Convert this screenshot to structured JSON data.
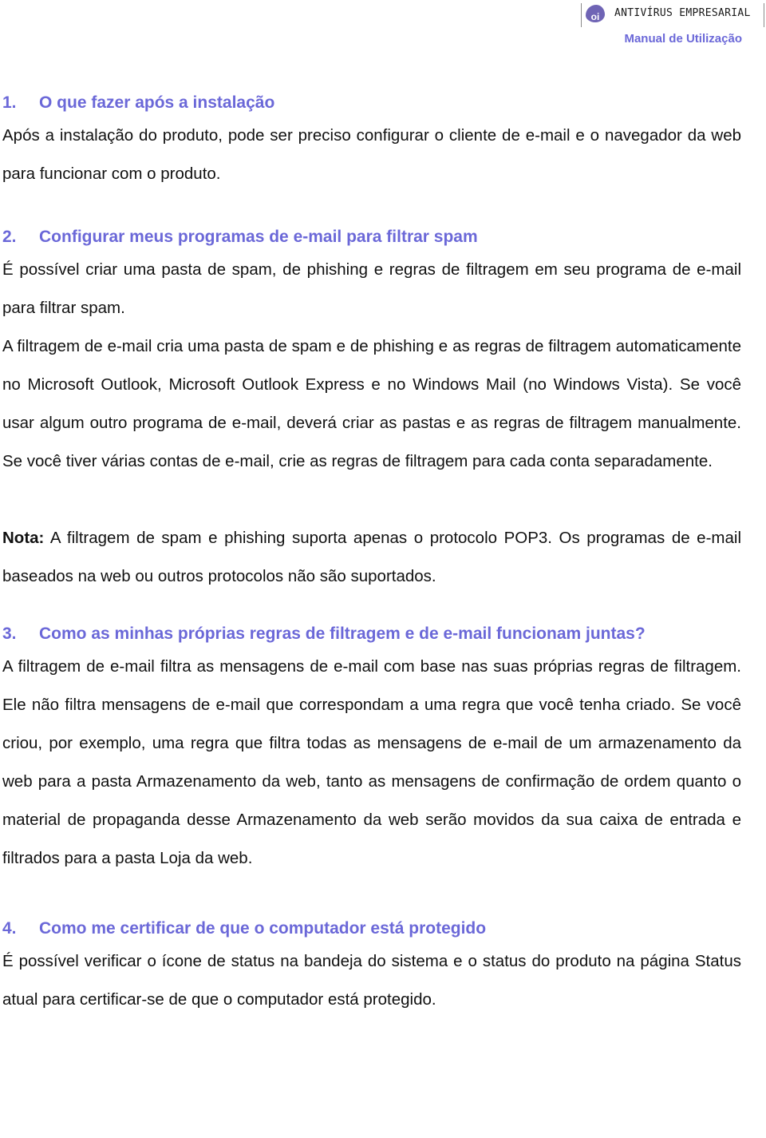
{
  "header": {
    "logo_text": "oi",
    "brand": "ANTIVÍRUS EMPRESARIAL",
    "subtitle": "Manual de Utilização",
    "accent_color": "#6b68d8",
    "logo_color": "#6f64b5"
  },
  "sections": [
    {
      "number": "1.",
      "title": "O que fazer após a instalação",
      "paragraphs": [
        "Após a instalação do produto, pode ser preciso configurar o cliente de e-mail e o navegador da web para funcionar com o produto."
      ]
    },
    {
      "number": "2.",
      "title": "Configurar meus programas de e-mail para filtrar spam",
      "paragraphs": [
        "É possível criar uma pasta de spam, de phishing e regras de filtragem em seu programa de e-mail para filtrar spam.",
        "A filtragem de e-mail cria uma pasta de spam e de phishing e as regras de filtragem automaticamente no Microsoft Outlook, Microsoft Outlook Express e no Windows Mail (no Windows Vista). Se você usar algum outro programa de e-mail, deverá criar as pastas e as regras de filtragem manualmente. Se você tiver várias contas de e-mail, crie as regras de filtragem para cada conta separadamente."
      ],
      "note": {
        "label": "Nota:",
        "text": " A filtragem de spam e phishing suporta apenas o protocolo POP3. Os programas de e-mail baseados na web ou outros protocolos não são suportados."
      }
    },
    {
      "number": "3.",
      "title": "Como as minhas próprias regras de filtragem e de e-mail funcionam juntas?",
      "paragraphs": [
        "A filtragem de e-mail filtra as mensagens de e-mail com base nas suas próprias regras de filtragem. Ele não filtra mensagens de e-mail que correspondam a uma regra que você tenha criado. Se você criou, por exemplo, uma regra que filtra todas as mensagens de e-mail de um armazenamento da web para a pasta Armazenamento da web, tanto as mensagens de confirmação de ordem quanto o material de propaganda desse Armazenamento da web serão movidos da sua caixa de entrada e filtrados para a pasta Loja da web."
      ]
    },
    {
      "number": "4.",
      "title": "Como me certificar de que o computador está protegido",
      "paragraphs": [
        "É possível verificar o ícone de status na bandeja do sistema e o status do produto na página Status atual para certificar-se de que o computador está protegido."
      ]
    }
  ]
}
